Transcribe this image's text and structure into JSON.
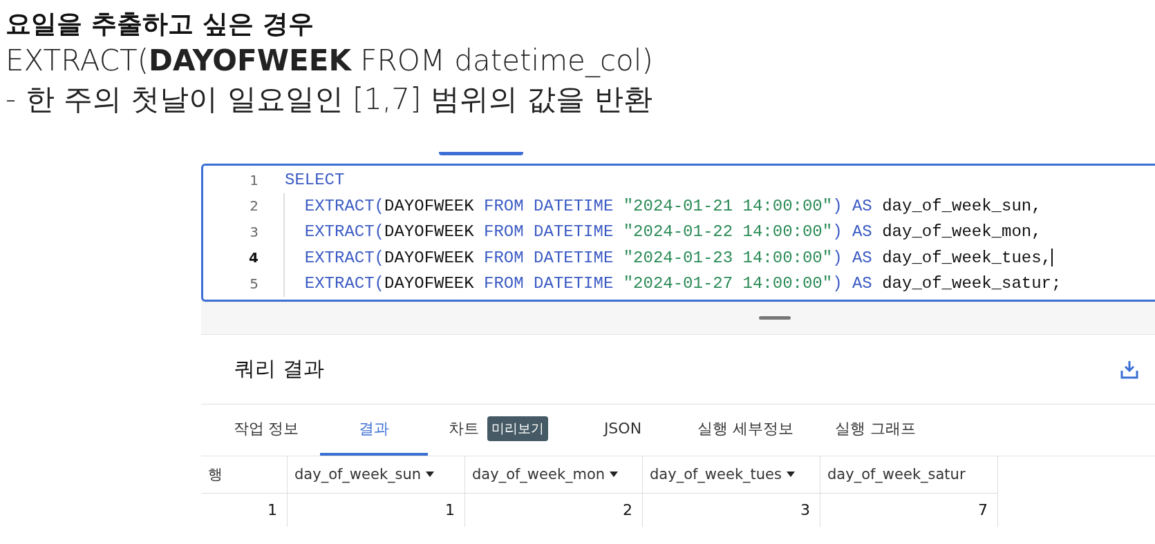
{
  "slide": {
    "title": "요일을 추출하고 싶은 경우",
    "syntax": "EXTRACT(**DAYOFWEEK** FROM datetime_col)",
    "note": "- 한 주의 첫날이 일요일인 [1,7] 범위의 값을 반환"
  },
  "editor": {
    "lines": [
      {
        "number": "1",
        "active": false,
        "cursor": false,
        "tokens": [
          {
            "kind": "keyword",
            "text": "SELECT"
          }
        ]
      },
      {
        "number": "2",
        "active": false,
        "cursor": false,
        "tokens": [
          {
            "kind": "keyword",
            "text": "  EXTRACT("
          },
          {
            "kind": "plain",
            "text": "DAYOFWEEK "
          },
          {
            "kind": "keyword",
            "text": "FROM DATETIME "
          },
          {
            "kind": "string",
            "text": "\"2024-01-21 14:00:00\""
          },
          {
            "kind": "keyword",
            "text": ") AS "
          },
          {
            "kind": "plain",
            "text": "day_of_week_sun,"
          }
        ]
      },
      {
        "number": "3",
        "active": false,
        "cursor": false,
        "tokens": [
          {
            "kind": "keyword",
            "text": "  EXTRACT("
          },
          {
            "kind": "plain",
            "text": "DAYOFWEEK "
          },
          {
            "kind": "keyword",
            "text": "FROM DATETIME "
          },
          {
            "kind": "string",
            "text": "\"2024-01-22 14:00:00\""
          },
          {
            "kind": "keyword",
            "text": ") AS "
          },
          {
            "kind": "plain",
            "text": "day_of_week_mon,"
          }
        ]
      },
      {
        "number": "4",
        "active": true,
        "cursor": true,
        "tokens": [
          {
            "kind": "keyword",
            "text": "  EXTRACT("
          },
          {
            "kind": "plain",
            "text": "DAYOFWEEK "
          },
          {
            "kind": "keyword",
            "text": "FROM DATETIME "
          },
          {
            "kind": "string",
            "text": "\"2024-01-23 14:00:00\""
          },
          {
            "kind": "keyword",
            "text": ") AS "
          },
          {
            "kind": "plain",
            "text": "day_of_week_tues,"
          }
        ]
      },
      {
        "number": "5",
        "active": false,
        "cursor": false,
        "tokens": [
          {
            "kind": "keyword",
            "text": "  EXTRACT("
          },
          {
            "kind": "plain",
            "text": "DAYOFWEEK "
          },
          {
            "kind": "keyword",
            "text": "FROM DATETIME "
          },
          {
            "kind": "string",
            "text": "\"2024-01-27 14:00:00\""
          },
          {
            "kind": "keyword",
            "text": ") AS "
          },
          {
            "kind": "plain",
            "text": "day_of_week_satur;"
          }
        ]
      }
    ]
  },
  "results": {
    "title": "쿼리 결과",
    "tabs": [
      {
        "label": "작업 정보",
        "selected": false
      },
      {
        "label": "결과",
        "selected": true
      },
      {
        "label": "차트",
        "badge": "미리보기",
        "selected": false
      },
      {
        "label": "JSON",
        "selected": false
      },
      {
        "label": "실행 세부정보",
        "selected": false
      },
      {
        "label": "실행 그래프",
        "selected": false
      }
    ],
    "table": {
      "columns": [
        {
          "label": "행",
          "menu": false
        },
        {
          "label": "day_of_week_sun",
          "menu": true
        },
        {
          "label": "day_of_week_mon",
          "menu": true
        },
        {
          "label": "day_of_week_tues",
          "menu": true
        },
        {
          "label": "day_of_week_satur",
          "menu": false
        }
      ],
      "rows": [
        [
          "1",
          "1",
          "2",
          "3",
          "7"
        ]
      ]
    }
  }
}
